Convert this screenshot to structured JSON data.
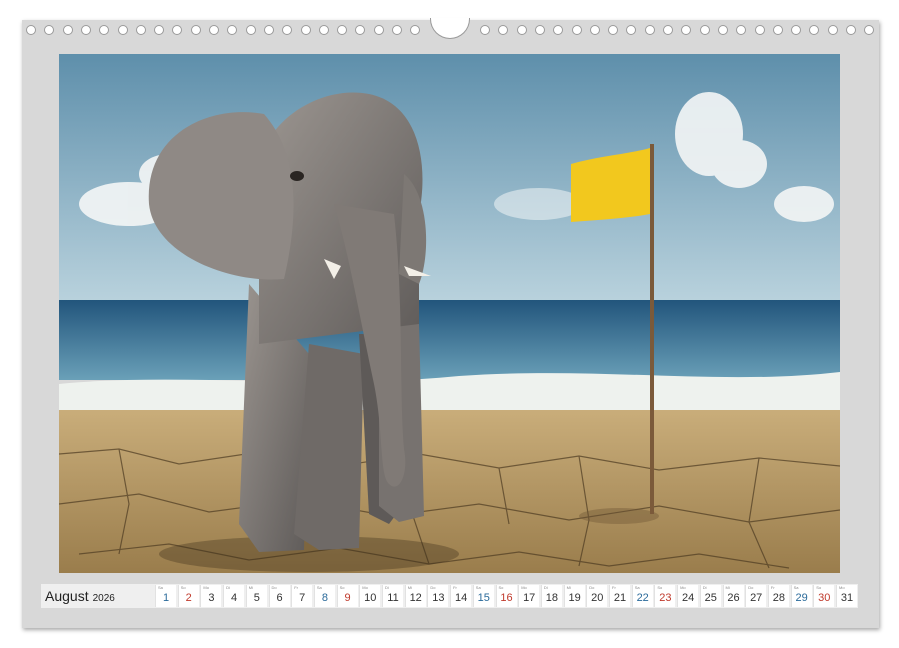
{
  "calendar": {
    "month": "August",
    "year": "2026",
    "days": [
      {
        "dn": "Sa",
        "n": "1",
        "t": "sat"
      },
      {
        "dn": "So",
        "n": "2",
        "t": "sun"
      },
      {
        "dn": "Mo",
        "n": "3",
        "t": ""
      },
      {
        "dn": "Di",
        "n": "4",
        "t": ""
      },
      {
        "dn": "Mi",
        "n": "5",
        "t": ""
      },
      {
        "dn": "Do",
        "n": "6",
        "t": ""
      },
      {
        "dn": "Fr",
        "n": "7",
        "t": ""
      },
      {
        "dn": "Sa",
        "n": "8",
        "t": "sat"
      },
      {
        "dn": "So",
        "n": "9",
        "t": "sun"
      },
      {
        "dn": "Mo",
        "n": "10",
        "t": ""
      },
      {
        "dn": "Di",
        "n": "11",
        "t": ""
      },
      {
        "dn": "Mi",
        "n": "12",
        "t": ""
      },
      {
        "dn": "Do",
        "n": "13",
        "t": ""
      },
      {
        "dn": "Fr",
        "n": "14",
        "t": ""
      },
      {
        "dn": "Sa",
        "n": "15",
        "t": "sat"
      },
      {
        "dn": "So",
        "n": "16",
        "t": "sun"
      },
      {
        "dn": "Mo",
        "n": "17",
        "t": ""
      },
      {
        "dn": "Di",
        "n": "18",
        "t": ""
      },
      {
        "dn": "Mi",
        "n": "19",
        "t": ""
      },
      {
        "dn": "Do",
        "n": "20",
        "t": ""
      },
      {
        "dn": "Fr",
        "n": "21",
        "t": ""
      },
      {
        "dn": "Sa",
        "n": "22",
        "t": "sat"
      },
      {
        "dn": "So",
        "n": "23",
        "t": "sun"
      },
      {
        "dn": "Mo",
        "n": "24",
        "t": ""
      },
      {
        "dn": "Di",
        "n": "25",
        "t": ""
      },
      {
        "dn": "Mi",
        "n": "26",
        "t": ""
      },
      {
        "dn": "Do",
        "n": "27",
        "t": ""
      },
      {
        "dn": "Fr",
        "n": "28",
        "t": ""
      },
      {
        "dn": "Sa",
        "n": "29",
        "t": "sat"
      },
      {
        "dn": "So",
        "n": "30",
        "t": "sun"
      },
      {
        "dn": "Mo",
        "n": "31",
        "t": ""
      }
    ]
  },
  "photo": {
    "sky_color": "#6f9fb8",
    "sea_color": "#2f6a90",
    "sand_color": "#b89a62",
    "flag_color": "#f2c81e"
  }
}
